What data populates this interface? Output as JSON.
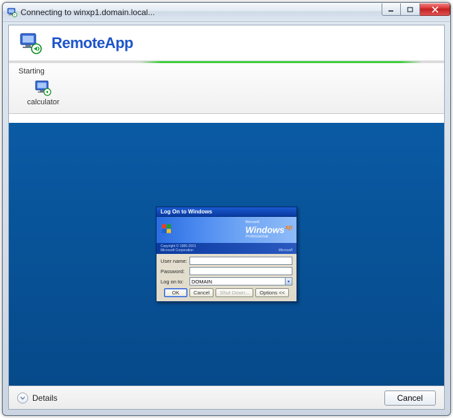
{
  "window": {
    "title": "Connecting to winxp1.domain.local..."
  },
  "header": {
    "app_title": "RemoteApp"
  },
  "starting": {
    "label": "Starting",
    "item_label": "calculator"
  },
  "logon": {
    "title": "Log On to Windows",
    "brand_ms": "Microsoft",
    "brand_win": "Windows",
    "brand_xp": "xp",
    "brand_pro": "Professional",
    "copyright": "Copyright © 1985-2001",
    "copyright2": "Microsoft Corporation",
    "ms_label": "Microsoft",
    "username_label": "User name:",
    "password_label": "Password:",
    "logonto_label": "Log on to:",
    "username_value": "",
    "password_value": "",
    "domain_value": "DOMAIN",
    "btn_ok": "OK",
    "btn_cancel": "Cancel",
    "btn_shutdown": "Shut Down...",
    "btn_options": "Options <<"
  },
  "footer": {
    "details": "Details",
    "cancel": "Cancel"
  }
}
